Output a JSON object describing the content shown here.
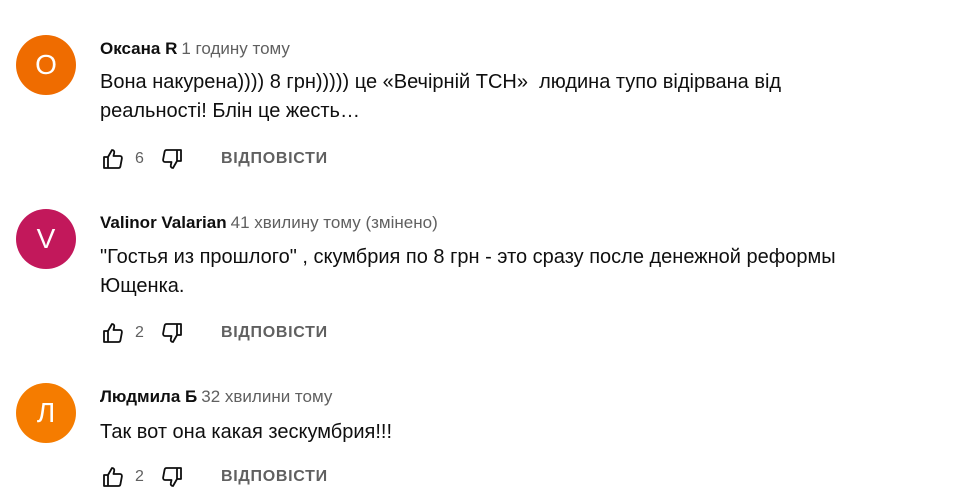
{
  "comments": [
    {
      "avatar_letter": "О",
      "avatar_color": "#ef6c00",
      "author": "Оксана R",
      "time": "1 годину тому",
      "text": "Вона накурена)))) 8 грн))))) це «Вечірній ТСН»  людина тупо відірвана від\nреальності! Блін це жесть…",
      "likes": "6",
      "reply_label": "ВІДПОВІСТИ"
    },
    {
      "avatar_letter": "V",
      "avatar_color": "#c2185b",
      "author": "Valinor Valarian",
      "time": "41 хвилину тому (змінено)",
      "text": "\"Гостья из прошлого\" , скумбрия по 8 грн - это сразу после денежной реформы\nЮщенка.",
      "likes": "2",
      "reply_label": "ВІДПОВІСТИ"
    },
    {
      "avatar_letter": "Л",
      "avatar_color": "#f57c00",
      "author": "Людмила Б",
      "time": "32 хвилини тому",
      "text": "Так вот она какая зескумбрия!!!",
      "likes": "2",
      "reply_label": "ВІДПОВІСТИ"
    }
  ],
  "icons": {
    "like": "thumb-up-icon",
    "dislike": "thumb-down-icon"
  }
}
